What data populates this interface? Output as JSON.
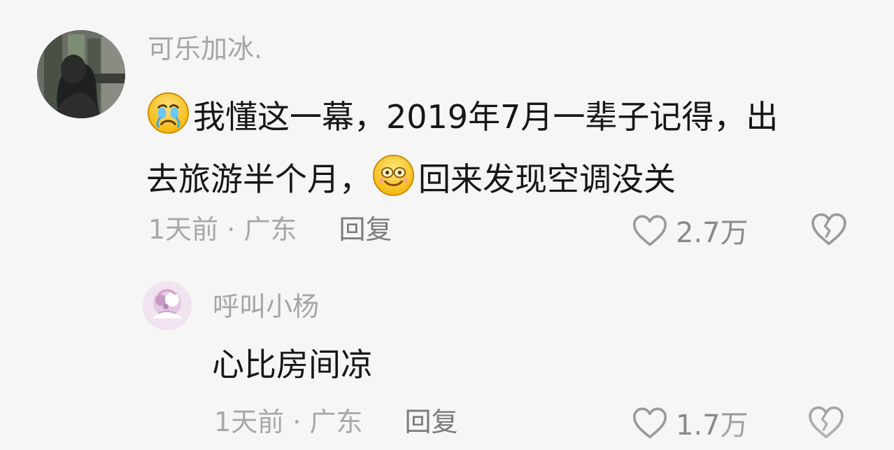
{
  "comment": {
    "author": "可乐加冰.",
    "line1_text": "我懂这一幕，2019年7月一辈子记得，出",
    "line2_prefix": "去旅游半个月，",
    "line2_suffix": "回来发现空调没关",
    "time": "1天前",
    "separator": " · ",
    "location": "广东",
    "reply": "回复",
    "likes": "2.7万",
    "emoji1": "crying-face",
    "emoji2": "grinning-face"
  },
  "reply_comment": {
    "author": "呼叫小杨",
    "text": "心比房间凉",
    "time": "1天前",
    "separator": " · ",
    "location": "广东",
    "reply": "回复",
    "likes": "1.7万"
  },
  "colors": {
    "background": "#f6f6f6",
    "username": "#a6a6a6",
    "text": "#161616",
    "meta": "#a8a8a8",
    "reply": "#7b7b7b"
  },
  "icons": {
    "like": "heart-outline-icon",
    "dislike": "broken-heart-icon"
  }
}
